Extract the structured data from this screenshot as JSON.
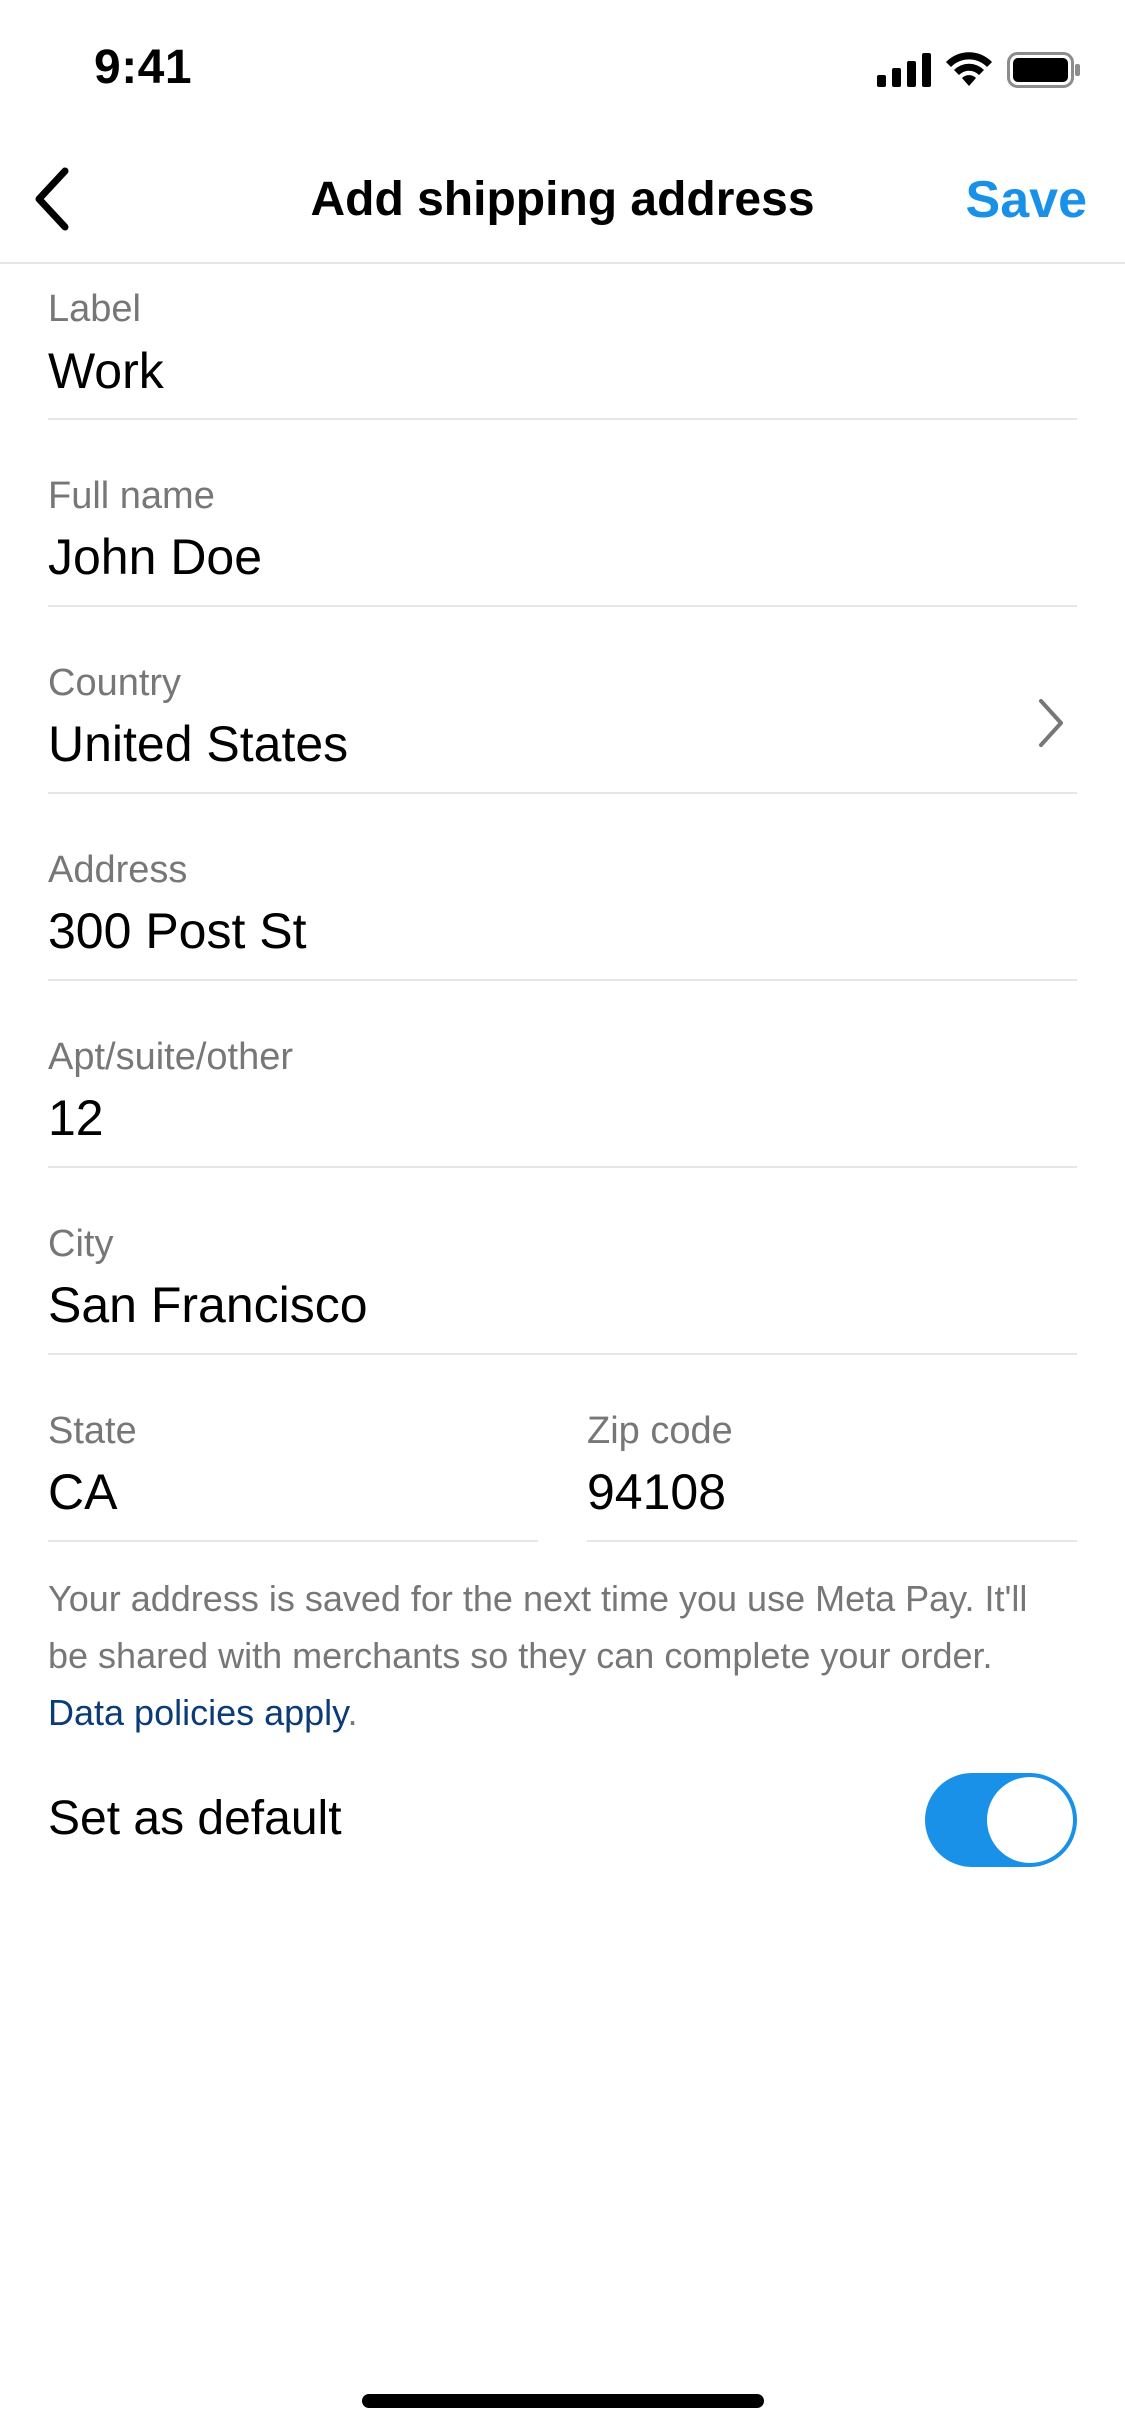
{
  "status_bar": {
    "time": "9:41",
    "icons": [
      "cellular-signal-icon",
      "wifi-icon",
      "battery-icon"
    ]
  },
  "nav": {
    "title": "Add shipping address",
    "save_label": "Save",
    "back_icon": "chevron-left-icon"
  },
  "form": {
    "label": {
      "label": "Label",
      "value": "Work"
    },
    "full_name": {
      "label": "Full name",
      "value": "John Doe"
    },
    "country": {
      "label": "Country",
      "value": "United States"
    },
    "address": {
      "label": "Address",
      "value": "300 Post St"
    },
    "apt": {
      "label": "Apt/suite/other",
      "value": "12"
    },
    "city": {
      "label": "City",
      "value": "San Francisco"
    },
    "state": {
      "label": "State",
      "value": "CA"
    },
    "zip": {
      "label": "Zip code",
      "value": "94108"
    }
  },
  "disclaimer": {
    "text": "Your address is saved for the next time you use Meta Pay. It'll be shared with merchants so they can complete your order. ",
    "link": "Data policies apply",
    "end": "."
  },
  "default_setting": {
    "label": "Set as default",
    "enabled": true
  },
  "colors": {
    "accent": "#1a91e8",
    "link": "#0b3b78",
    "label_gray": "#777777",
    "divider": "#e6e6e6"
  }
}
